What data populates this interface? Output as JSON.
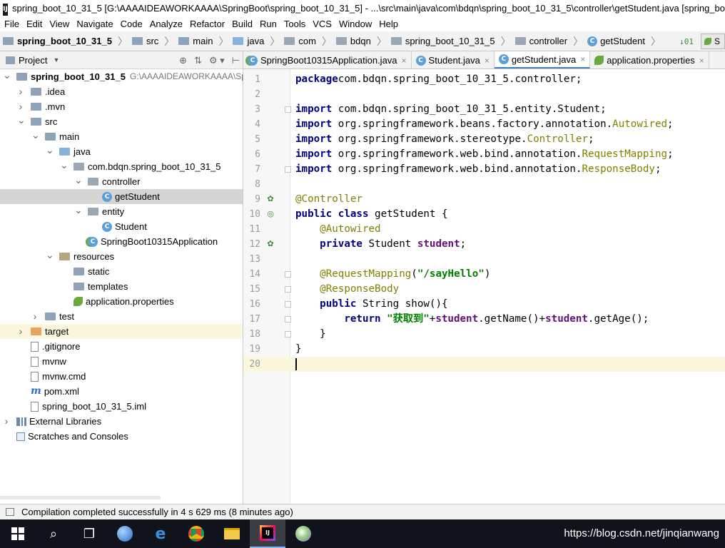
{
  "title_bar": {
    "app_icon": "intellij-icon",
    "text": "spring_boot_10_31_5 [G:\\AAAAIDEAWORKAAAA\\SpringBoot\\spring_boot_10_31_5] - ...\\src\\main\\java\\com\\bdqn\\spring_boot_10_31_5\\controller\\getStudent.java [spring_bo"
  },
  "menu": [
    "File",
    "Edit",
    "View",
    "Navigate",
    "Code",
    "Analyze",
    "Refactor",
    "Build",
    "Run",
    "Tools",
    "VCS",
    "Window",
    "Help"
  ],
  "breadcrumbs": [
    "spring_boot_10_31_5",
    "src",
    "main",
    "java",
    "com",
    "bdqn",
    "spring_boot_10_31_5",
    "controller",
    "getStudent"
  ],
  "nav_right": {
    "sort_icon": "↓01",
    "run_label": "S"
  },
  "project_panel": {
    "header_label": "Project",
    "tree": [
      {
        "label": "spring_boot_10_31_5",
        "path": "G:\\AAAAIDEAWORKAAAA\\Spr",
        "indent": 0,
        "arrow": "open",
        "icon": "folder-icon",
        "bold": true
      },
      {
        "label": ".idea",
        "indent": 1,
        "arrow": "closed",
        "icon": "folder-icon"
      },
      {
        "label": ".mvn",
        "indent": 1,
        "arrow": "closed",
        "icon": "folder-icon"
      },
      {
        "label": "src",
        "indent": 1,
        "arrow": "open",
        "icon": "folder-icon"
      },
      {
        "label": "main",
        "indent": 2,
        "arrow": "open",
        "icon": "folder-icon"
      },
      {
        "label": "java",
        "indent": 3,
        "arrow": "open",
        "icon": "source-folder-icon"
      },
      {
        "label": "com.bdqn.spring_boot_10_31_5",
        "indent": 4,
        "arrow": "open",
        "icon": "package-icon"
      },
      {
        "label": "controller",
        "indent": 5,
        "arrow": "open",
        "icon": "package-icon"
      },
      {
        "label": "getStudent",
        "indent": 6,
        "arrow": "none",
        "icon": "class-icon",
        "selected": true
      },
      {
        "label": "entity",
        "indent": 5,
        "arrow": "open",
        "icon": "package-icon"
      },
      {
        "label": "Student",
        "indent": 6,
        "arrow": "none",
        "icon": "class-icon"
      },
      {
        "label": "SpringBoot10315Application",
        "indent": 5,
        "arrow": "none",
        "icon": "spring-class-icon"
      },
      {
        "label": "resources",
        "indent": 3,
        "arrow": "open",
        "icon": "resources-folder-icon"
      },
      {
        "label": "static",
        "indent": 4,
        "arrow": "none",
        "icon": "folder-icon"
      },
      {
        "label": "templates",
        "indent": 4,
        "arrow": "none",
        "icon": "folder-icon"
      },
      {
        "label": "application.properties",
        "indent": 4,
        "arrow": "none",
        "icon": "spring-leaf-icon"
      },
      {
        "label": "test",
        "indent": 2,
        "arrow": "closed",
        "icon": "folder-icon"
      },
      {
        "label": "target",
        "indent": 1,
        "arrow": "closed",
        "icon": "orange-folder-icon",
        "highlight": true
      },
      {
        "label": ".gitignore",
        "indent": 1,
        "arrow": "none",
        "icon": "file-icon"
      },
      {
        "label": "mvnw",
        "indent": 1,
        "arrow": "none",
        "icon": "file-icon"
      },
      {
        "label": "mvnw.cmd",
        "indent": 1,
        "arrow": "none",
        "icon": "file-icon"
      },
      {
        "label": "pom.xml",
        "indent": 1,
        "arrow": "none",
        "icon": "maven-icon"
      },
      {
        "label": "spring_boot_10_31_5.iml",
        "indent": 1,
        "arrow": "none",
        "icon": "file-icon"
      },
      {
        "label": "External Libraries",
        "indent": 0,
        "arrow": "closed",
        "icon": "library-icon"
      },
      {
        "label": "Scratches and Consoles",
        "indent": 0,
        "arrow": "none",
        "icon": "scratches-icon"
      }
    ]
  },
  "editor_tabs": [
    {
      "label": "SpringBoot10315Application.java",
      "icon": "spring-class-icon",
      "active": false
    },
    {
      "label": "Student.java",
      "icon": "class-icon",
      "active": false
    },
    {
      "label": "getStudent.java",
      "icon": "class-icon",
      "active": true
    },
    {
      "label": "application.properties",
      "icon": "spring-leaf-icon",
      "active": false
    }
  ],
  "code_lines": [
    {
      "n": "1",
      "parts": [
        [
          "kw",
          "package"
        ],
        [
          "",
          "com.bdqn.spring_boot_10_31_5.controller;"
        ]
      ]
    },
    {
      "n": "2",
      "parts": []
    },
    {
      "n": "3",
      "parts": [
        [
          "kw",
          "import"
        ],
        [
          "",
          " com.bdqn.spring_boot_10_31_5.entity.Student;"
        ]
      ]
    },
    {
      "n": "4",
      "parts": [
        [
          "kw",
          "import"
        ],
        [
          "",
          " org.springframework.beans.factory.annotation."
        ],
        [
          "an",
          "Autowired"
        ],
        [
          "",
          ";"
        ]
      ]
    },
    {
      "n": "5",
      "parts": [
        [
          "kw",
          "import"
        ],
        [
          "",
          " org.springframework.stereotype."
        ],
        [
          "an",
          "Controller"
        ],
        [
          "",
          ";"
        ]
      ]
    },
    {
      "n": "6",
      "parts": [
        [
          "kw",
          "import"
        ],
        [
          "",
          " org.springframework.web.bind.annotation."
        ],
        [
          "an",
          "RequestMapping"
        ],
        [
          "",
          ";"
        ]
      ]
    },
    {
      "n": "7",
      "parts": [
        [
          "kw",
          "import"
        ],
        [
          "",
          " org.springframework.web.bind.annotation."
        ],
        [
          "an",
          "ResponseBody"
        ],
        [
          "",
          ";"
        ]
      ]
    },
    {
      "n": "8",
      "parts": []
    },
    {
      "n": "9",
      "parts": [
        [
          "an",
          "@Controller"
        ]
      ]
    },
    {
      "n": "10",
      "parts": [
        [
          "kw",
          "public class"
        ],
        [
          "",
          " getStudent {"
        ]
      ]
    },
    {
      "n": "11",
      "parts": [
        [
          "",
          "    "
        ],
        [
          "an",
          "@Autowired"
        ]
      ]
    },
    {
      "n": "12",
      "parts": [
        [
          "",
          "    "
        ],
        [
          "kw",
          "private"
        ],
        [
          "",
          " Student "
        ],
        [
          "fld",
          "student"
        ],
        [
          "",
          ";"
        ]
      ]
    },
    {
      "n": "13",
      "parts": []
    },
    {
      "n": "14",
      "parts": [
        [
          "",
          "    "
        ],
        [
          "an",
          "@RequestMapping"
        ],
        [
          "",
          "("
        ],
        [
          "str",
          "\"/sayHello\""
        ],
        [
          "",
          ")"
        ]
      ]
    },
    {
      "n": "15",
      "parts": [
        [
          "",
          "    "
        ],
        [
          "an",
          "@ResponseBody"
        ]
      ]
    },
    {
      "n": "16",
      "parts": [
        [
          "",
          "    "
        ],
        [
          "kw",
          "public"
        ],
        [
          "",
          " String show(){"
        ]
      ]
    },
    {
      "n": "17",
      "parts": [
        [
          "",
          "        "
        ],
        [
          "kw",
          "return"
        ],
        [
          "",
          ""
        ],
        [
          "str",
          " \"获取到\""
        ],
        [
          "",
          "+"
        ],
        [
          "fld",
          "student"
        ],
        [
          "",
          ".getName()+"
        ],
        [
          "fld",
          "student"
        ],
        [
          "",
          ".getAge();"
        ]
      ]
    },
    {
      "n": "18",
      "parts": [
        [
          "",
          "    }"
        ]
      ]
    },
    {
      "n": "19",
      "parts": [
        [
          "",
          "}"
        ]
      ]
    },
    {
      "n": "20",
      "parts": [],
      "current": true
    }
  ],
  "status_bar": {
    "message": "Compilation completed successfully in 4 s 629 ms (8 minutes ago)"
  },
  "taskbar": {
    "watermark": "https://blog.csdn.net/jinqianwang"
  }
}
